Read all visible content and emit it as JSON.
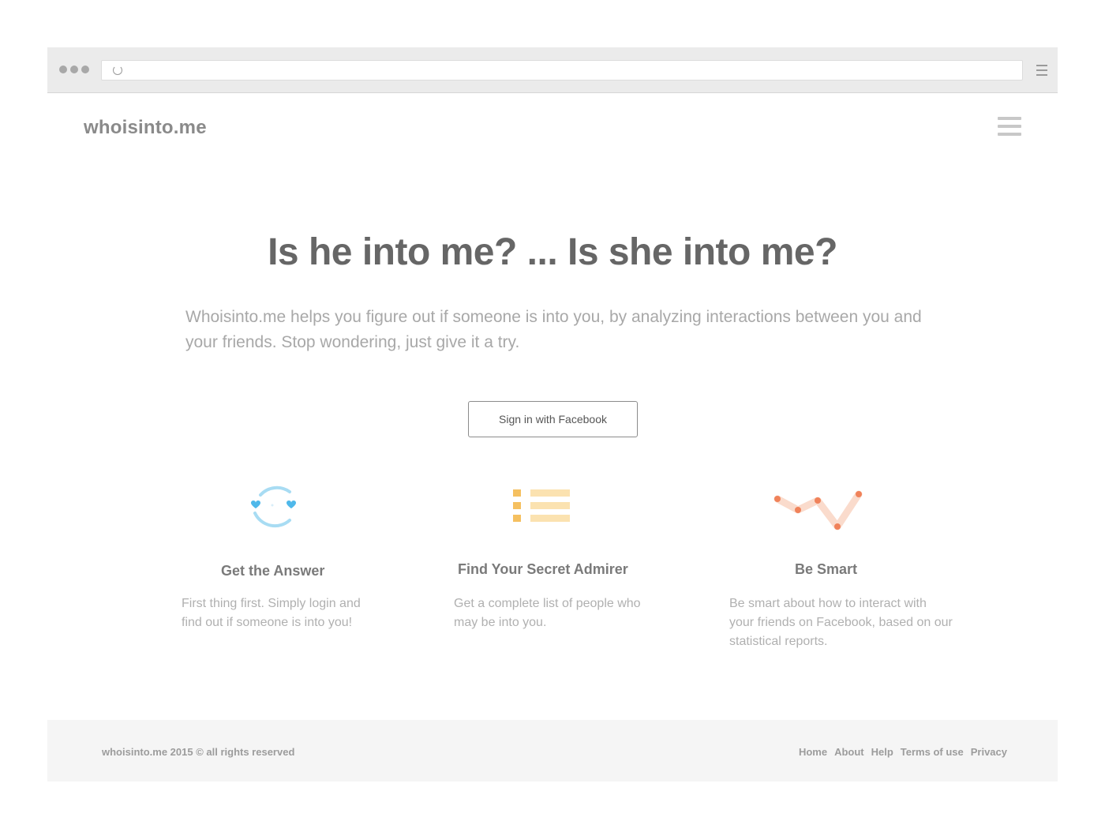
{
  "browser": {
    "window_dots": [
      "close",
      "minimize",
      "maximize"
    ],
    "address": ""
  },
  "header": {
    "logo": "whoisinto.me"
  },
  "hero": {
    "title": "Is he into me? ... Is she into me?",
    "subtitle": "Whoisinto.me helps you figure out if someone is into you, by analyzing interactions between you and your friends. Stop wondering, just give it a try.",
    "cta_label": "Sign in with Facebook"
  },
  "features": [
    {
      "icon": "hearts-cycle-icon",
      "title": "Get the Answer",
      "text": "First thing first. Simply login and find out if someone is into you!"
    },
    {
      "icon": "list-icon",
      "title": "Find Your Secret Admirer",
      "text": "Get a complete list of people who may be into you."
    },
    {
      "icon": "line-chart-icon",
      "title": "Be Smart",
      "text": "Be smart about how to interact with your friends on Facebook, based on our statistical reports."
    }
  ],
  "footer": {
    "copyright": "whoisinto.me 2015 © all rights reserved",
    "links": [
      "Home",
      "About",
      "Help",
      "Terms of use",
      "Privacy"
    ]
  },
  "colors": {
    "heart_blue": "#5bc0eb",
    "list_orange": "#f5b041",
    "chart_orange": "#f0825a"
  }
}
